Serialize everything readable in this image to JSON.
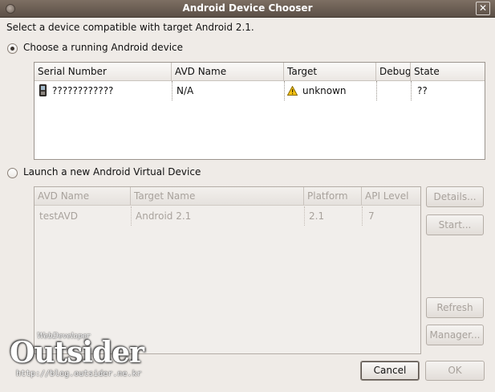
{
  "window": {
    "title": "Android Device Chooser",
    "close_label": "✕"
  },
  "intro": "Select a device compatible with target Android 2.1.",
  "running": {
    "radio_label": "Choose a running Android device",
    "selected": true,
    "columns": [
      "Serial Number",
      "AVD Name",
      "Target",
      "Debug",
      "State"
    ],
    "rows": [
      {
        "serial": "????????????",
        "avd": "N/A",
        "target": "unknown",
        "debug": "",
        "state": "??"
      }
    ]
  },
  "launch": {
    "radio_label": "Launch a new Android Virtual Device",
    "selected": false,
    "columns": [
      "AVD Name",
      "Target Name",
      "Platform",
      "API Level"
    ],
    "rows": [
      {
        "avd": "testAVD",
        "target": "Android 2.1",
        "platform": "2.1",
        "api": "7"
      }
    ],
    "buttons": {
      "details": "Details...",
      "start": "Start...",
      "refresh": "Refresh",
      "manager": "Manager..."
    }
  },
  "footer": {
    "cancel": "Cancel",
    "ok": "OK"
  },
  "watermark": {
    "small": "WebDeveloper",
    "big": "Outsider",
    "url": "http://blog.outsider.ne.kr"
  }
}
